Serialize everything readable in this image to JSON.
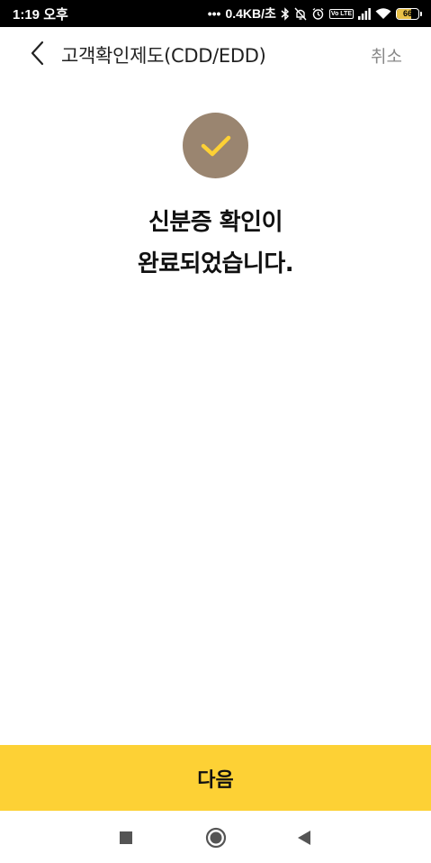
{
  "status_bar": {
    "time": "1:19 오후",
    "network_speed": "0.4KB/초",
    "volte": "Vo LTE",
    "battery_level": "66",
    "battery_fraction": 0.66,
    "icons": [
      "bluetooth-icon",
      "mute-icon",
      "alarm-icon",
      "signal-icon",
      "wifi-icon",
      "battery-icon"
    ]
  },
  "header": {
    "title": "고객확인제도(CDD/EDD)",
    "cancel_label": "취소"
  },
  "main": {
    "message_line1": "신분증 확인이",
    "message_line2": "완료되었습니다.",
    "check_circle_color": "#9a8570",
    "check_mark_color": "#fdd135"
  },
  "footer": {
    "next_label": "다음",
    "next_button_color": "#fdd135"
  },
  "nav_bar": {
    "buttons": [
      "recents-button",
      "home-button",
      "back-nav-button"
    ]
  }
}
